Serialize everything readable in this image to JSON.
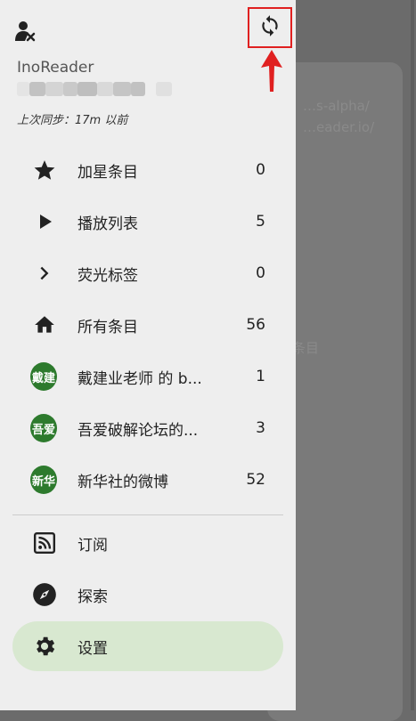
{
  "background": {
    "line1": "…s-alpha/",
    "line2": "…eader.io/",
    "line3": "条目"
  },
  "header": {
    "app_name": "InoReader",
    "last_sync": "上次同步：17m 以前",
    "account_icon": "account-remove-icon",
    "sync_icon": "sync-icon"
  },
  "menu": [
    {
      "label": "加星条目",
      "count": "0",
      "icon": "star-icon"
    },
    {
      "label": "播放列表",
      "count": "5",
      "icon": "play-icon"
    },
    {
      "label": "荧光标签",
      "count": "0",
      "icon": "chevron-right-icon"
    },
    {
      "label": "所有条目",
      "count": "56",
      "icon": "home-icon"
    },
    {
      "label": "戴建业老师 的 b...",
      "count": "1",
      "icon_text": "戴建"
    },
    {
      "label": "吾爱破解论坛的...",
      "count": "3",
      "icon_text": "吾爱"
    },
    {
      "label": "新华社的微博",
      "count": "52",
      "icon_text": "新华"
    }
  ],
  "bottom_menu": [
    {
      "label": "订阅",
      "icon": "rss-icon"
    },
    {
      "label": "探索",
      "icon": "compass-icon"
    },
    {
      "label": "设置",
      "icon": "settings-icon",
      "active": true
    }
  ],
  "colors": {
    "drawer_bg": "#eeeeee",
    "active_bg": "#d8e8d0",
    "feed_icon": "#2d7a2d",
    "highlight": "#e02020"
  }
}
